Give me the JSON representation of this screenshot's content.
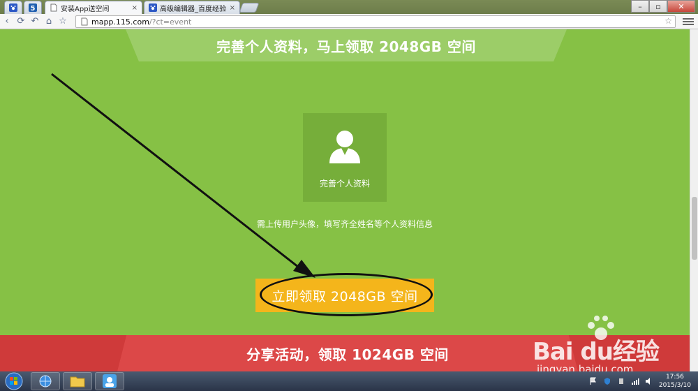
{
  "browser": {
    "tabs": [
      {
        "title": "安装App送空间",
        "active": true
      },
      {
        "title": "高级编辑器_百度经验",
        "active": false
      }
    ],
    "close_glyph": "×",
    "address": {
      "host": "mapp.115.com",
      "path": "/?ct=event"
    }
  },
  "page": {
    "top_banner": "完善个人资料，马上领取 2048GB 空间",
    "card_label": "完善个人资料",
    "hint": "需上传用户头像，填写齐全姓名等个人资料信息",
    "claim_button": "立即领取 2048GB 空间",
    "bottom_banner": "分享活动，领取 1024GB 空间"
  },
  "watermark": {
    "logo": "Bai du经验",
    "url": "jingyan.baidu.com"
  },
  "taskbar": {
    "time": "17:56",
    "date": "2015/3/10"
  },
  "colors": {
    "page_bg": "#86c145",
    "card_bg": "#76ae3a",
    "claim_button": "#f4b51b",
    "bottom_banner": "#cf3a3a"
  }
}
